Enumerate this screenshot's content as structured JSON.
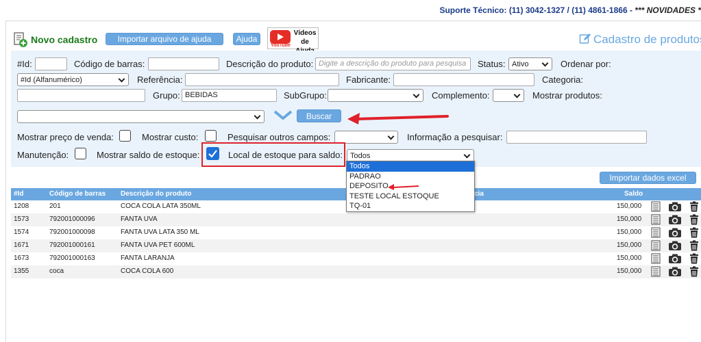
{
  "header": {
    "support_label": "Suporte Técnico: (11) 3042-1327 / (11) 4861-1866 -",
    "support_news": "*** NOVIDADES *",
    "new_label": "Novo cadastro",
    "import_help_label": "Importar arquivo de ajuda",
    "help_label": "Ajuda",
    "videos_label_1": "Vídeos",
    "videos_label_2": "de Ajuda",
    "youtube_label": "YouTube",
    "page_title": "Cadastro de produtos"
  },
  "filters": {
    "id_label": "#Id:",
    "barcode_label": "Código de barras:",
    "description_label": "Descrição do produto:",
    "description_placeholder": "Digite a descrição do produto para pesquisa",
    "status_label": "Status:",
    "status_value": "Ativo",
    "order_label": "Ordenar por:",
    "order_value": "#Id (Alfanumérico)",
    "reference_label": "Referência:",
    "manufacturer_label": "Fabricante:",
    "category_label": "Categoria:",
    "group_label": "Grupo:",
    "group_value": "BEBIDAS",
    "subgroup_label": "SubGrupo:",
    "complement_label": "Complemento:",
    "show_products_label": "Mostrar produtos:",
    "search_label": "Buscar",
    "show_price_label": "Mostrar preço de venda:",
    "show_cost_label": "Mostrar custo:",
    "search_other_label": "Pesquisar outros campos:",
    "info_search_label": "Informação a pesquisar:",
    "maintenance_label": "Manutenção:",
    "show_stock_label": "Mostrar saldo de estoque:",
    "stock_location_label": "Local de estoque para saldo:",
    "stock_location_value": "Todos",
    "stock_location_options": [
      "Todos",
      "PADRAO",
      "DEPOSITO",
      "TESTE LOCAL ESTOQUE",
      "TQ-01"
    ]
  },
  "import_excel_label": "Importar dados excel",
  "table": {
    "columns": [
      "#Id",
      "Código de barras",
      "Descrição do produto",
      "cia",
      "Saldo"
    ],
    "rows": [
      {
        "id": "1208",
        "barcode": "201",
        "desc": "COCA COLA LATA 350ML",
        "saldo": "150,000"
      },
      {
        "id": "1573",
        "barcode": "792001000096",
        "desc": "FANTA UVA",
        "saldo": "150,000"
      },
      {
        "id": "1574",
        "barcode": "792001000098",
        "desc": "FANTA UVA LATA 350 ML",
        "saldo": "150,000"
      },
      {
        "id": "1671",
        "barcode": "792001000161",
        "desc": "FANTA UVA PET 600ML",
        "saldo": "150,000"
      },
      {
        "id": "1673",
        "barcode": "792001000163",
        "desc": "FANTA LARANJA",
        "saldo": "150,000"
      },
      {
        "id": "1355",
        "barcode": "coca",
        "desc": "COCA COLA 600",
        "saldo": "150,000"
      }
    ]
  },
  "colors": {
    "accent": "#6aa7e0",
    "highlight": "#e0202a",
    "panel": "#eaf3fb",
    "selected": "#1e70d8"
  }
}
